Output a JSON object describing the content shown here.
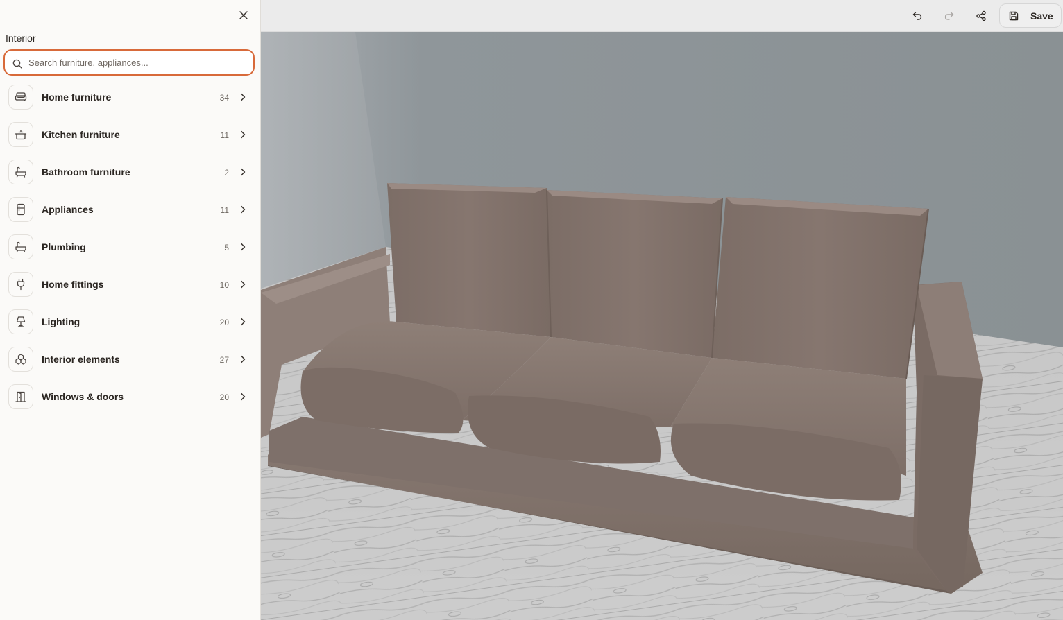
{
  "panel": {
    "title": "Interior",
    "search_placeholder": "Search furniture, appliances...",
    "categories": [
      {
        "label": "Home furniture",
        "count": "34",
        "icon": "sofa-icon"
      },
      {
        "label": "Kitchen furniture",
        "count": "11",
        "icon": "pot-icon"
      },
      {
        "label": "Bathroom furniture",
        "count": "2",
        "icon": "bathtub-icon"
      },
      {
        "label": "Appliances",
        "count": "11",
        "icon": "fridge-icon"
      },
      {
        "label": "Plumbing",
        "count": "5",
        "icon": "bath-icon"
      },
      {
        "label": "Home fittings",
        "count": "10",
        "icon": "plug-icon"
      },
      {
        "label": "Lighting",
        "count": "20",
        "icon": "lamp-icon"
      },
      {
        "label": "Interior elements",
        "count": "27",
        "icon": "boxes-icon"
      },
      {
        "label": "Windows & doors",
        "count": "20",
        "icon": "door-icon"
      }
    ]
  },
  "toolbar": {
    "save_label": "Save"
  },
  "colors": {
    "accent": "#d86a3a",
    "wall": "#8f969a",
    "sofa": "#7f7069",
    "floor": "#c9c9c9"
  }
}
